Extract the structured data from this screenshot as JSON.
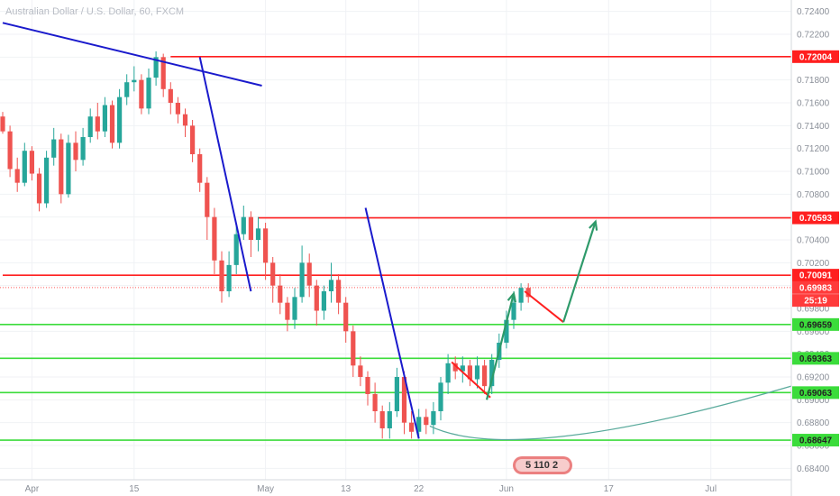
{
  "chart_data": {
    "type": "candlestick",
    "title": "Australian Dollar / U.S. Dollar, 60, FXCM",
    "ylim": [
      0.683,
      0.725
    ],
    "y_ticks": [
      0.724,
      0.722,
      0.72,
      0.718,
      0.716,
      0.714,
      0.712,
      0.71,
      0.708,
      0.706,
      0.704,
      0.702,
      0.7,
      0.698,
      0.696,
      0.694,
      0.692,
      0.69,
      0.688,
      0.686,
      0.684
    ],
    "x_ticks": [
      {
        "label": "Apr",
        "i": 4
      },
      {
        "label": "15",
        "i": 18
      },
      {
        "label": "May",
        "i": 36
      },
      {
        "label": "13",
        "i": 47
      },
      {
        "label": "22",
        "i": 57
      },
      {
        "label": "Jun",
        "i": 69
      },
      {
        "label": "17",
        "i": 83
      },
      {
        "label": "Jul",
        "i": 97
      }
    ],
    "price_tags": [
      {
        "value": "0.72004",
        "price": 0.72004,
        "bg": "#ff1f1f",
        "fg": "#ffffff"
      },
      {
        "value": "0.70593",
        "price": 0.70593,
        "bg": "#ff1f1f",
        "fg": "#ffffff"
      },
      {
        "value": "0.70091",
        "price": 0.70091,
        "bg": "#ff1f1f",
        "fg": "#ffffff"
      },
      {
        "value": "0.69983",
        "price": 0.69983,
        "bg": "#ff3b3b",
        "fg": "#ffffff"
      },
      {
        "value": "25:19",
        "price": 0.6987,
        "bg": "#ff3b3b",
        "fg": "#ffffff"
      },
      {
        "value": "0.69659",
        "price": 0.69659,
        "bg": "#3bdc3b",
        "fg": "#222222"
      },
      {
        "value": "0.69363",
        "price": 0.69363,
        "bg": "#3bdc3b",
        "fg": "#222222"
      },
      {
        "value": "0.69063",
        "price": 0.69063,
        "bg": "#3bdc3b",
        "fg": "#222222"
      },
      {
        "value": "0.68647",
        "price": 0.68647,
        "bg": "#3bdc3b",
        "fg": "#222222"
      }
    ],
    "resistance_lines": [
      {
        "price": 0.72004,
        "i0": 23,
        "i1": 110,
        "color": "#ff1f1f"
      },
      {
        "price": 0.70593,
        "i0": 35,
        "i1": 110,
        "color": "#ff1f1f"
      },
      {
        "price": 0.70091,
        "i0": 0,
        "i1": 110,
        "color": "#ff1f1f"
      }
    ],
    "support_lines": [
      {
        "price": 0.69659,
        "color": "#3bdc3b"
      },
      {
        "price": 0.69363,
        "color": "#3bdc3b"
      },
      {
        "price": 0.69063,
        "color": "#3bdc3b"
      },
      {
        "price": 0.68647,
        "color": "#3bdc3b"
      }
    ],
    "current_price": 0.69983,
    "trend_lines": [
      {
        "i0": 0,
        "p0": 0.723,
        "i1": 35.5,
        "p1": 0.7175,
        "color": "#1a1acc"
      },
      {
        "i0": 27,
        "p0": 0.72,
        "i1": 34,
        "p1": 0.6995,
        "color": "#1a1acc"
      },
      {
        "i0": 49.7,
        "p0": 0.7068,
        "i1": 57,
        "p1": 0.6866,
        "color": "#1a1acc"
      }
    ],
    "zigzag_red": [
      {
        "i0": 61.5,
        "p0": 0.6933,
        "i1": 66.8,
        "p1": 0.6902
      },
      {
        "i0": 71.5,
        "p0": 0.6995,
        "i1": 76.8,
        "p1": 0.6968
      }
    ],
    "arrows_green": [
      {
        "i0": 66.3,
        "p0": 0.69,
        "i1": 70,
        "p1": 0.6993
      },
      {
        "i0": 76.8,
        "p0": 0.6968,
        "i1": 81.2,
        "p1": 0.7056
      }
    ],
    "arc": {
      "i0": 58.5,
      "p0": 0.6877,
      "imid": 77,
      "pmid": 0.6868,
      "i1": 109,
      "p1": 0.6912,
      "color": "#5aaa9c"
    },
    "watermark": "5  110  2",
    "candles": [
      [
        0.7148,
        0.7135,
        0.7152,
        0.7133
      ],
      [
        0.7135,
        0.7102,
        0.714,
        0.7095
      ],
      [
        0.7102,
        0.709,
        0.7112,
        0.7082
      ],
      [
        0.709,
        0.7118,
        0.7125,
        0.7087
      ],
      [
        0.7118,
        0.7098,
        0.7122,
        0.7092
      ],
      [
        0.7098,
        0.7072,
        0.7103,
        0.7065
      ],
      [
        0.7072,
        0.7112,
        0.7118,
        0.7068
      ],
      [
        0.7112,
        0.7128,
        0.7138,
        0.7105
      ],
      [
        0.7128,
        0.708,
        0.7133,
        0.7072
      ],
      [
        0.708,
        0.7125,
        0.7132,
        0.7077
      ],
      [
        0.7125,
        0.711,
        0.7135,
        0.71
      ],
      [
        0.711,
        0.713,
        0.7138,
        0.7105
      ],
      [
        0.713,
        0.7148,
        0.7155,
        0.7125
      ],
      [
        0.7148,
        0.7135,
        0.716,
        0.7128
      ],
      [
        0.7135,
        0.7158,
        0.7165,
        0.713
      ],
      [
        0.7158,
        0.7125,
        0.7162,
        0.712
      ],
      [
        0.7125,
        0.7165,
        0.7172,
        0.712
      ],
      [
        0.7165,
        0.7178,
        0.7185,
        0.7158
      ],
      [
        0.7178,
        0.718,
        0.7192,
        0.717
      ],
      [
        0.718,
        0.7155,
        0.7185,
        0.715
      ],
      [
        0.7155,
        0.7182,
        0.719,
        0.715
      ],
      [
        0.7182,
        0.72,
        0.7205,
        0.7175
      ],
      [
        0.72,
        0.7172,
        0.7203,
        0.7165
      ],
      [
        0.7172,
        0.716,
        0.7178,
        0.715
      ],
      [
        0.716,
        0.715,
        0.7165,
        0.7142
      ],
      [
        0.715,
        0.714,
        0.7155,
        0.713
      ],
      [
        0.714,
        0.7115,
        0.7145,
        0.7108
      ],
      [
        0.7115,
        0.709,
        0.712,
        0.7082
      ],
      [
        0.709,
        0.706,
        0.7095,
        0.704
      ],
      [
        0.706,
        0.7022,
        0.7068,
        0.701
      ],
      [
        0.7022,
        0.6995,
        0.703,
        0.6985
      ],
      [
        0.6995,
        0.7018,
        0.703,
        0.699
      ],
      [
        0.7018,
        0.7045,
        0.7055,
        0.701
      ],
      [
        0.7045,
        0.706,
        0.707,
        0.704
      ],
      [
        0.706,
        0.704,
        0.7065,
        0.7025
      ],
      [
        0.704,
        0.705,
        0.706,
        0.703
      ],
      [
        0.705,
        0.702,
        0.7055,
        0.7005
      ],
      [
        0.702,
        0.7,
        0.7025,
        0.6985
      ],
      [
        0.7,
        0.6985,
        0.701,
        0.6975
      ],
      [
        0.6985,
        0.697,
        0.699,
        0.696
      ],
      [
        0.697,
        0.699,
        0.6998,
        0.6962
      ],
      [
        0.699,
        0.702,
        0.7035,
        0.6985
      ],
      [
        0.702,
        0.7,
        0.7028,
        0.699
      ],
      [
        0.7,
        0.6978,
        0.7005,
        0.6965
      ],
      [
        0.6978,
        0.6995,
        0.7,
        0.697
      ],
      [
        0.6995,
        0.7005,
        0.702,
        0.6985
      ],
      [
        0.7005,
        0.6985,
        0.701,
        0.6975
      ],
      [
        0.6985,
        0.696,
        0.699,
        0.695
      ],
      [
        0.696,
        0.693,
        0.6965,
        0.692
      ],
      [
        0.693,
        0.692,
        0.6938,
        0.6912
      ],
      [
        0.692,
        0.6905,
        0.6925,
        0.6895
      ],
      [
        0.6905,
        0.689,
        0.6915,
        0.688
      ],
      [
        0.689,
        0.6875,
        0.6895,
        0.6866
      ],
      [
        0.6875,
        0.689,
        0.6898,
        0.6866
      ],
      [
        0.689,
        0.692,
        0.6928,
        0.6885
      ],
      [
        0.692,
        0.688,
        0.6925,
        0.687
      ],
      [
        0.688,
        0.6872,
        0.689,
        0.6866
      ],
      [
        0.6872,
        0.6885,
        0.6892,
        0.6866
      ],
      [
        0.6885,
        0.6878,
        0.6892,
        0.687
      ],
      [
        0.6878,
        0.689,
        0.6898,
        0.687
      ],
      [
        0.689,
        0.6915,
        0.692,
        0.6882
      ],
      [
        0.6915,
        0.6932,
        0.694,
        0.6905
      ],
      [
        0.6932,
        0.6925,
        0.6938,
        0.6918
      ],
      [
        0.6925,
        0.693,
        0.6938,
        0.6915
      ],
      [
        0.693,
        0.6918,
        0.6935,
        0.6912
      ],
      [
        0.6918,
        0.693,
        0.6938,
        0.691
      ],
      [
        0.693,
        0.6912,
        0.6935,
        0.6905
      ],
      [
        0.6912,
        0.6935,
        0.694,
        0.6905
      ],
      [
        0.6935,
        0.695,
        0.6958,
        0.6928
      ],
      [
        0.695,
        0.697,
        0.6978,
        0.6945
      ],
      [
        0.697,
        0.6985,
        0.6995,
        0.6962
      ],
      [
        0.6985,
        0.6998,
        0.7002,
        0.6978
      ],
      [
        0.6998,
        0.699,
        0.7002,
        0.6985
      ]
    ]
  }
}
